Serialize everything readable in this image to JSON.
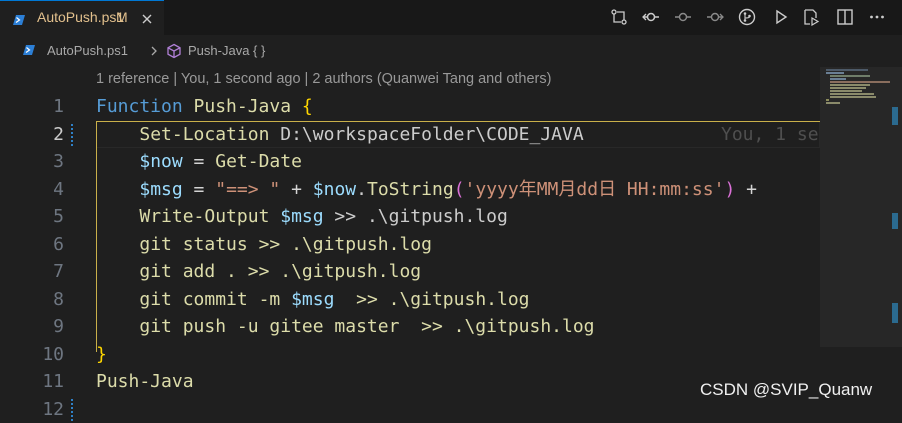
{
  "tab": {
    "label": "AutoPush.ps1",
    "modified": "M"
  },
  "toolbar": {
    "icons": [
      "source-control-compare-icon",
      "git-commit-icon",
      "git-prev-icon",
      "git-next-icon",
      "git-history-icon",
      "run-icon",
      "run-and-debug-icon",
      "split-editor-icon",
      "more-icon"
    ]
  },
  "breadcrumb": {
    "file": "AutoPush.ps1",
    "symbol": "Push-Java { }"
  },
  "codelens": "1 reference | You, 1 second ago | 2 authors (Quanwei Tang and others)",
  "blame": "You, 1 se",
  "lines": [
    "1",
    "2",
    "3",
    "4",
    "5",
    "6",
    "7",
    "8",
    "9",
    "10",
    "11",
    "12"
  ],
  "code": {
    "l1_keyword": "Function",
    "l1_name": " Push-Java ",
    "l1_brace": "{",
    "l2_cmd": "Set-Location",
    "l2_arg": " D:\\workspaceFolder\\CODE_JAVA",
    "l3_var": "$now",
    "l3_op": " = ",
    "l3_cmd": "Get-Date",
    "l4_var": "$msg",
    "l4_op": " = ",
    "l4_str": "\"==> \"",
    "l4_plus": " + ",
    "l4_var2": "$now",
    "l4_dot": ".",
    "l4_method": "ToString",
    "l4_paren_open": "(",
    "l4_str2": "'yyyy年MM月dd日 HH:mm:ss'",
    "l4_paren_close": ")",
    "l4_tail": " +",
    "l5_cmd": "Write-Output",
    "l5_var": " $msg",
    "l5_rest": " >> .\\gitpush.log",
    "l6": "git status >> .\\gitpush.log",
    "l7": "git add . >> .\\gitpush.log",
    "l8_a": "git commit -m ",
    "l8_var": "$msg",
    "l8_b": "  >> .\\gitpush.log",
    "l9": "git push -u gitee master  >> .\\gitpush.log",
    "l10_brace": "}",
    "l11_cmd": "Push-Java"
  },
  "watermark": "CSDN @SVIP_Quanw",
  "colors": {
    "accent": "#0078d4",
    "modified": "#e2c08d",
    "keyword": "#569cd6",
    "function": "#dcdcaa",
    "variable": "#9cdcfe",
    "string": "#ce9178",
    "brace": "#ffd700"
  }
}
